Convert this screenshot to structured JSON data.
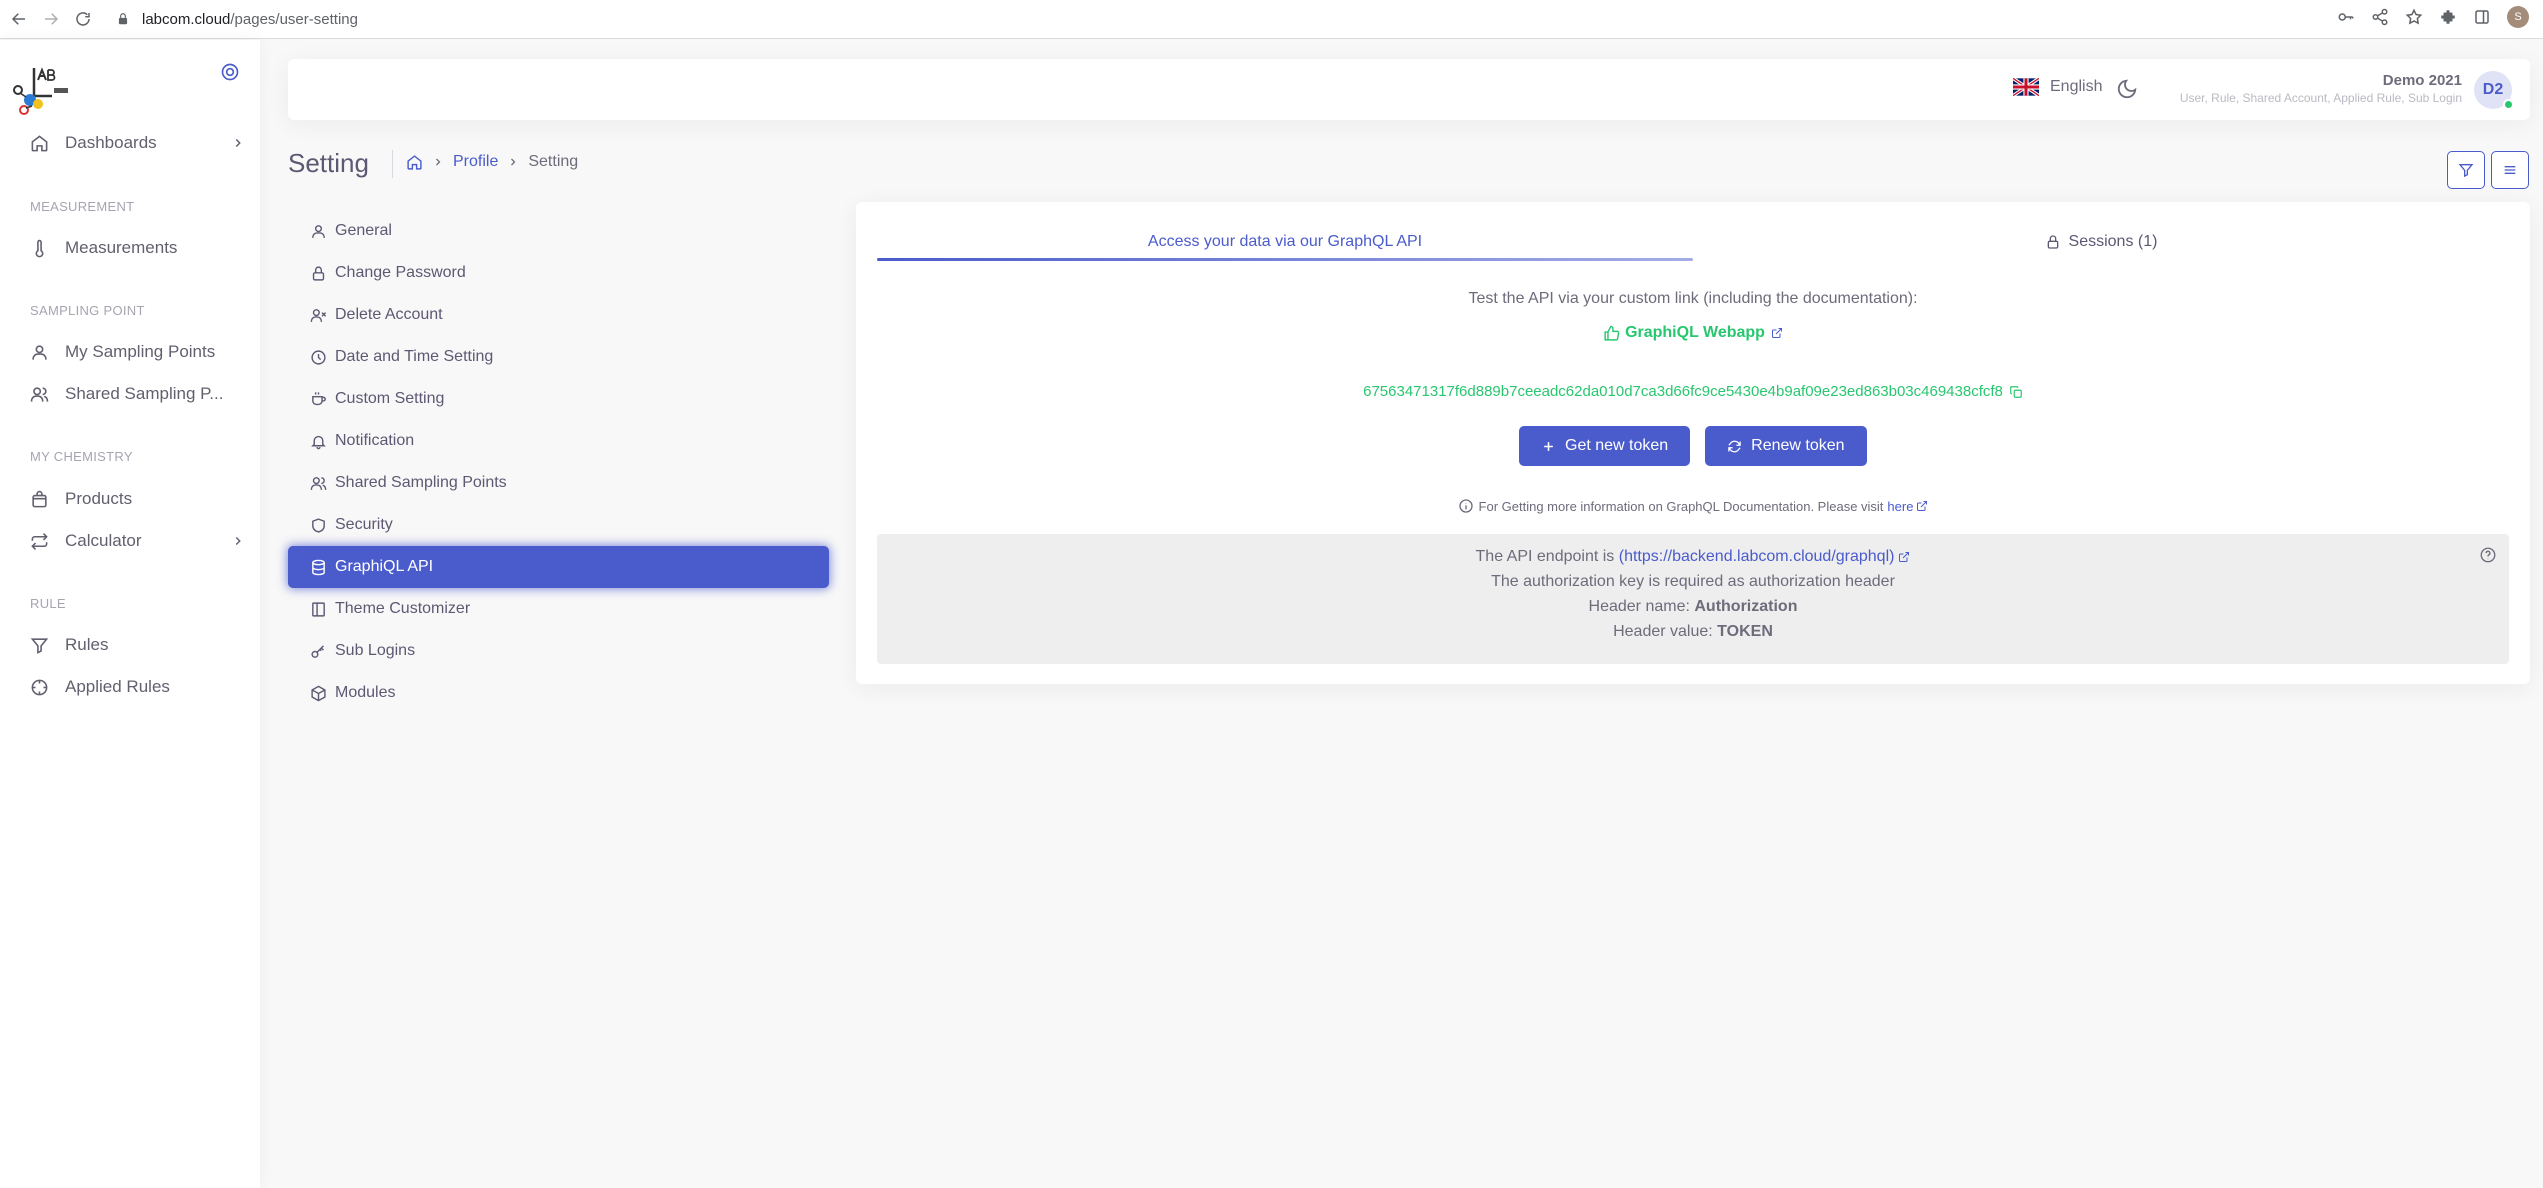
{
  "browser": {
    "url_host": "labcom.cloud",
    "url_path": "/pages/user-setting",
    "profile_initial": "S"
  },
  "sidebar": {
    "dashboards": "Dashboards",
    "section_measurement": "MEASUREMENT",
    "measurements": "Measurements",
    "section_sampling": "SAMPLING POINT",
    "my_sampling_points": "My Sampling Points",
    "shared_sampling_points": "Shared Sampling P...",
    "section_chemistry": "MY CHEMISTRY",
    "products": "Products",
    "calculator": "Calculator",
    "section_rule": "RULE",
    "rules": "Rules",
    "applied_rules": "Applied Rules"
  },
  "navbar": {
    "language": "English",
    "user_name": "Demo 2021",
    "user_role": "User, Rule, Shared Account, Applied Rule, Sub Login",
    "avatar_initials": "D2"
  },
  "page": {
    "title": "Setting",
    "breadcrumb_profile": "Profile",
    "breadcrumb_current": "Setting"
  },
  "menu": {
    "general": "General",
    "change_password": "Change Password",
    "delete_account": "Delete Account",
    "date_time": "Date and Time Setting",
    "custom_setting": "Custom Setting",
    "notification": "Notification",
    "shared_sampling_points": "Shared Sampling Points",
    "security": "Security",
    "graphql_api": "GraphiQL API",
    "theme_customizer": "Theme Customizer",
    "sub_logins": "Sub Logins",
    "modules": "Modules"
  },
  "card": {
    "tab_api": "Access your data via our GraphQL API",
    "tab_sessions": "Sessions (1)",
    "description": "Test the API via your custom link (including the documentation):",
    "webapp_link": "GraphiQL Webapp",
    "token": "67563471317f6d889b7ceeadc62da010d7ca3d66fc9ce5430e4b9af09e23ed863b03c469438cfcf8",
    "get_new_token": "Get new token",
    "renew_token": "Renew token",
    "info_text": "For Getting more information on GraphQL Documentation. Please visit",
    "info_link": "here",
    "endpoint_prefix": "The API endpoint is",
    "endpoint_url": "(https://backend.labcom.cloud/graphql)",
    "auth_note": "The authorization key is required as authorization header",
    "header_name_label": "Header name:",
    "header_name_value": "Authorization",
    "header_value_label": "Header value:",
    "header_value_value": "TOKEN"
  },
  "colors": {
    "primary": "#4a5bcc",
    "success": "#28c76f",
    "text": "#5e5873"
  }
}
